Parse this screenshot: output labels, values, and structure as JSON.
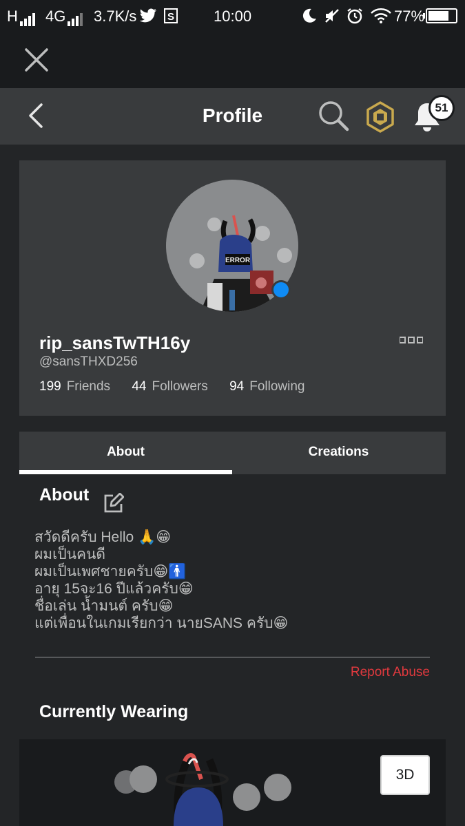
{
  "status_bar": {
    "network_left": "H",
    "network_right": "4G",
    "speed": "3.7K/s",
    "time": "10:00",
    "battery": "77%",
    "battery_level": 0.77,
    "icons": [
      "signal-icon",
      "twitter-icon",
      "s-app-icon",
      "moon-icon",
      "mute-icon",
      "alarm-icon",
      "wifi-icon",
      "battery-icon"
    ]
  },
  "header": {
    "title": "Profile",
    "notification_count": "51",
    "icons": [
      "close-icon",
      "back-icon",
      "search-icon",
      "robux-icon",
      "bell-icon"
    ],
    "robux_color": "#c9a94e"
  },
  "profile": {
    "display_name": "rip_sansTwTH16y",
    "username": "@sansTHXD256",
    "avatar_text": "ERROR",
    "online_color": "#0f8bf5",
    "stats": [
      {
        "count": "199",
        "label": "Friends"
      },
      {
        "count": "44",
        "label": "Followers"
      },
      {
        "count": "94",
        "label": "Following"
      }
    ]
  },
  "tabs": [
    {
      "label": "About",
      "active": true
    },
    {
      "label": "Creations",
      "active": false
    }
  ],
  "about": {
    "title": "About",
    "lines": [
      "สวัดดีครับ Hello 🙏😁",
      "ผมเป็นคนดี",
      "ผมเป็นเพศชายครับ😁🚹",
      "อายุ 15จะ16 ปีแล้วครับ😁",
      "ชื่อเล่น น้ำมนต์ ครับ😁",
      "แต่เพื่อนในเกมเรียกว่า นายSANS ครับ😁"
    ],
    "report_label": "Report Abuse",
    "report_color": "#e0393e"
  },
  "wearing": {
    "title": "Currently Wearing",
    "view_toggle_label": "3D"
  }
}
